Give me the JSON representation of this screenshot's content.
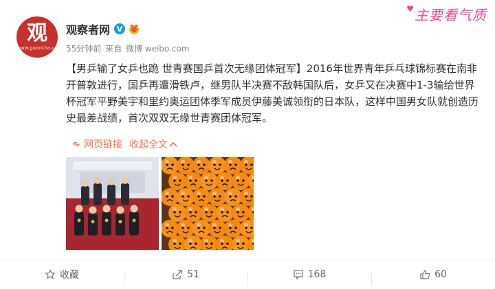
{
  "author": {
    "name": "观察者网",
    "avatar_glyph": "观",
    "avatar_site": "www.guancha.cn",
    "avatar_color": "#c8302c"
  },
  "meta": {
    "time": "55分钟前",
    "via_label": "来自",
    "source": "微博 weibo.com"
  },
  "watermark": "主要看气质",
  "post": {
    "topic": "【男乒输了女乒也跪 世青赛国乒首次无缘团体冠军】",
    "body": "2016年世界青年乒乓球锦标赛在南非开普敦进行，国乒再遭滑铁卢，继男队半决赛不敌韩国队后，女乒又在决赛中1-3输给世界杯冠军平野美宇和里约奥运团体季军成员伊藤美诚领衔的日本队，这样中国男女队就创造历史最差战绩，首次双双无缘世青赛团体冠军。"
  },
  "links": {
    "webpage": "网页链接",
    "collapse": "收起全文"
  },
  "actions": {
    "favorite": "收藏",
    "repost": "51",
    "comment": "168",
    "like": "60"
  },
  "colors": {
    "link": "#eb7350",
    "watermark": "#e9488f",
    "verified": "#1a9be6"
  }
}
